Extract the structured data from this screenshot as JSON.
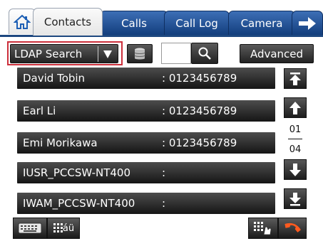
{
  "tabs": [
    {
      "label": "Contacts",
      "active": true
    },
    {
      "label": "Calls",
      "active": false
    },
    {
      "label": "Call Log",
      "active": false
    },
    {
      "label": "Camera",
      "active": false
    }
  ],
  "toolbar": {
    "search_mode": "LDAP Search",
    "search_value": "",
    "advanced_label": "Advanced"
  },
  "contacts": [
    {
      "name": "David Tobin",
      "phone": ": 0123456789"
    },
    {
      "name": "Earl Li",
      "phone": ": 0123456789"
    },
    {
      "name": "Emi Morikawa",
      "phone": ": 0123456789"
    },
    {
      "name": "IUSR_PCCSW-NT400",
      "phone": ":"
    },
    {
      "name": "IWAM_PCCSW-NT400",
      "phone": ":"
    }
  ],
  "pager": {
    "current": "01",
    "total": "04"
  },
  "bottom": {
    "chars_label": "áü"
  },
  "icons": {
    "home": "home-icon",
    "next": "arrow-right-icon",
    "dropdown": "caret-down-icon",
    "database": "database-icon",
    "search": "magnifier-icon",
    "first": "arrow-up-to-top-icon",
    "up": "arrow-up-icon",
    "down": "arrow-down-icon",
    "last": "arrow-down-to-bottom-icon",
    "keyboard": "keyboard-icon",
    "dialpad": "dialpad-icon",
    "hangup": "hangup-icon"
  },
  "colors": {
    "tab_blue": "#1f4f93",
    "highlight": "#cc2f3b",
    "row_dark": "#2b2b2b",
    "hangup": "#ff5a1f"
  }
}
